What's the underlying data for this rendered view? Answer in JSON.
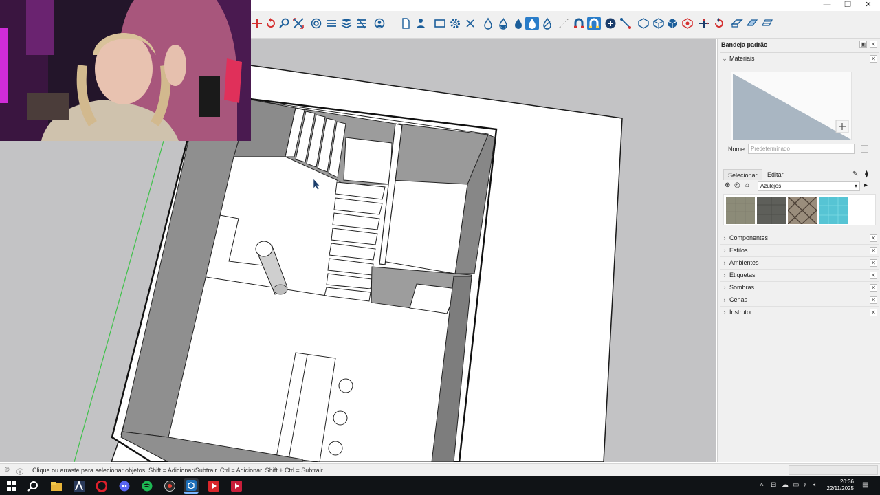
{
  "window": {
    "minimize_icon": "minimize-icon",
    "maximize_icon": "restore-icon",
    "close_icon": "close-icon"
  },
  "toolbar": {
    "tools": [
      "move-icon",
      "rotate-icon",
      "zoom-icon",
      "zoom-extents-icon",
      "orbit-icon",
      "layers-icon",
      "style-icon",
      "geo-icon",
      "user-icon",
      "page-icon",
      "person-icon",
      "rectangle-icon",
      "settings-icon",
      "close-icon",
      "drop-icon",
      "drop-icon",
      "drop-icon",
      "drop-icon",
      "drop-icon",
      "snap-icon",
      "magnet-icon",
      "magnet-icon",
      "add-icon",
      "line-icon",
      "cube-icon",
      "cube-icon",
      "cube-icon",
      "cube-icon",
      "axis-icon",
      "rotate-icon",
      "plane-icon",
      "plane-icon",
      "plane-icon"
    ],
    "active_tool": "drop-icon"
  },
  "tray": {
    "title": "Bandeja padrão",
    "materials_label": "Materiais",
    "name_label": "Nome",
    "name_placeholder": "Predeterminado",
    "tab_select": "Selecionar",
    "tab_edit": "Editar",
    "library": "Azulejos",
    "swatch_colors": [
      "#8c8b78",
      "#5e5f5a",
      "#9a8d7c",
      "#56c4d4"
    ],
    "sections": [
      {
        "label": "Componentes"
      },
      {
        "label": "Estilos"
      },
      {
        "label": "Ambientes"
      },
      {
        "label": "Etiquetas"
      },
      {
        "label": "Sombras"
      },
      {
        "label": "Cenas"
      },
      {
        "label": "Instrutor"
      }
    ]
  },
  "status": {
    "text": "Clique ou arraste para selecionar objetos. Shift = Adicionar/Subtrair. Ctrl = Adicionar. Shift + Ctrl = Subtrair."
  },
  "taskbar": {
    "time": "20:36",
    "date": "22/11/2025",
    "apps": [
      "windows-icon",
      "search-icon",
      "files-icon",
      "autocad-icon",
      "opera-icon",
      "discord-icon",
      "spotify-icon",
      "chrome-icon",
      "sketchup-icon",
      "media-icon",
      "media-icon"
    ]
  },
  "colors": {
    "accent": "#2a7dc9",
    "viewport_bg": "#c3c3c5",
    "floor": "#ffffff",
    "wall_shadow": "#8f8f8f",
    "axis_green": "#3fc24a"
  }
}
